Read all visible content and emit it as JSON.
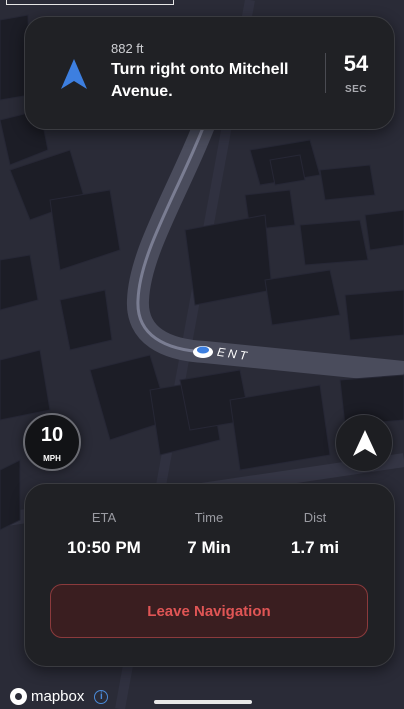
{
  "navigation": {
    "distance": "882 ft",
    "instruction": "Turn right onto Mitchell Avenue.",
    "time_value": "54",
    "time_unit": "SEC"
  },
  "map": {
    "street_label": "ENT"
  },
  "speed": {
    "value": "10",
    "unit": "MPH"
  },
  "trip": {
    "eta_label": "ETA",
    "eta_value": "10:50 PM",
    "time_label": "Time",
    "time_value": "7 Min",
    "dist_label": "Dist",
    "dist_value": "1.7 mi",
    "leave_label": "Leave Navigation"
  },
  "attribution": {
    "brand": "mapbox",
    "info_glyph": "i"
  },
  "colors": {
    "accent_blue": "#3d7fe0",
    "danger_red": "#e05555",
    "card_bg": "#202125"
  }
}
